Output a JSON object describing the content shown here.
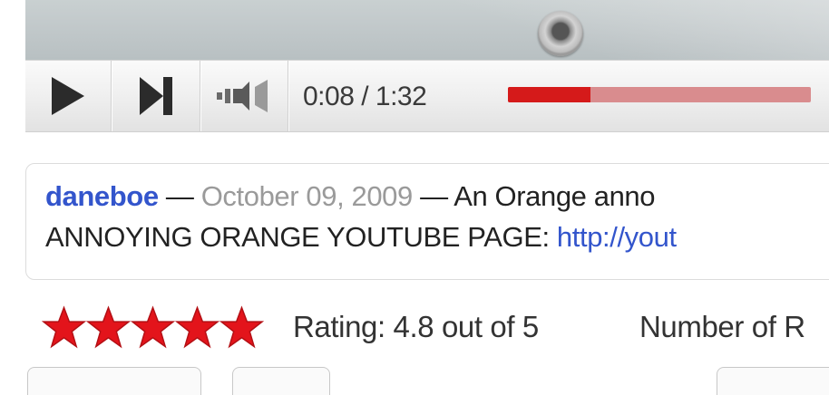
{
  "player": {
    "time_display": "0:08 / 1:32",
    "progress_fraction": 0.273,
    "colors": {
      "played": "#d51a1a",
      "buffered": "#d98c8e"
    },
    "icons": [
      "play-icon",
      "next-icon",
      "volume-icon"
    ]
  },
  "description": {
    "author": "daneboe",
    "sep1": " — ",
    "date": "October 09, 2009",
    "sep2": " — ",
    "text_start": "An Orange anno",
    "line2_text": "ANNOYING ORANGE YOUTUBE PAGE: ",
    "link_text": "http://yout"
  },
  "rating": {
    "stars": 5,
    "star_color": "#e3141b",
    "text": "Rating: 4.8 out of 5",
    "count_label": "Number of R"
  }
}
